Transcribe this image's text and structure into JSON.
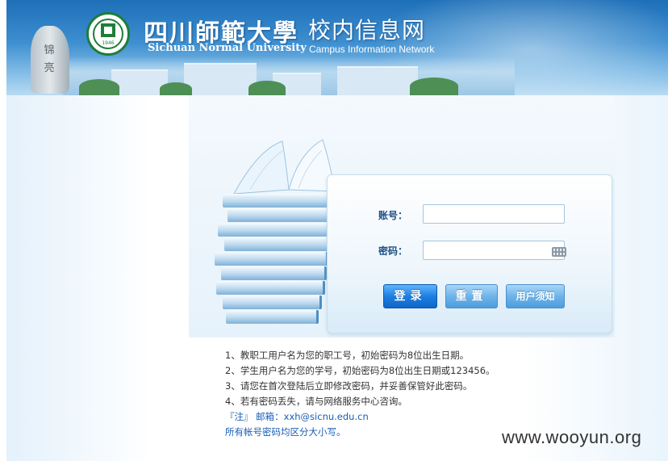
{
  "header": {
    "title_cn": "四川師範大學",
    "subtitle_cn": "校内信息网",
    "title_en": "Sichuan Normal University",
    "subtitle_en": "Campus Information Network",
    "seal_year": "1946",
    "rock_inscription": "锦亮"
  },
  "login": {
    "account_label": "账号：",
    "password_label": "密码：",
    "account_value": "",
    "password_value": "",
    "login_button": "登录",
    "reset_button": "重置",
    "notice_button": "用户须知"
  },
  "notes": {
    "line1": "1、教职工用户名为您的职工号，初始密码为8位出生日期。",
    "line2": "2、学生用户名为您的学号，初始密码为8位出生日期或123456。",
    "line3": "3、请您在首次登陆后立即修改密码，并妥善保管好此密码。",
    "line4": "4、若有密码丢失，请与网络服务中心咨询。",
    "email_line": "『注』 邮箱：xxh@sicnu.edu.cn",
    "case_line": "所有帐号密码均区分大小写。"
  },
  "watermark": "www.wooyun.org",
  "colors": {
    "label_blue": "#1c4f86",
    "note_blue": "#1a5fb4",
    "button_primary": "#1d7fe0",
    "button_secondary": "#6eb4e9",
    "seal_green": "#1f7d3a"
  }
}
